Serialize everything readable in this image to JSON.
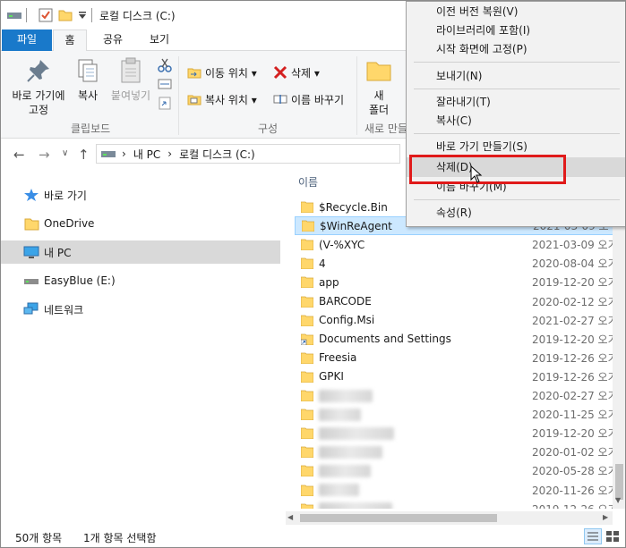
{
  "title": "로컬 디스크 (C:)",
  "ribbon_tabs": [
    "파일",
    "홈",
    "공유",
    "보기"
  ],
  "ribbon": {
    "pin_label": "바로 가기에\n고정",
    "copy_label": "복사",
    "paste_label": "붙여넣기",
    "clipboard_group": "클립보드",
    "move_to_label": "이동 위치 ▾",
    "copy_to_label": "복사 위치 ▾",
    "delete_label": "삭제 ▾",
    "rename_label": "이름 바꾸기",
    "organize_group": "구성",
    "new_folder_label": "새\n폴더",
    "new_group": "새로 만들"
  },
  "address": {
    "crumbs": [
      "내 PC",
      "로컬 디스크 (C:)"
    ]
  },
  "nav_pane": {
    "items": [
      {
        "label": "바로 가기",
        "icon": "star-icon"
      },
      {
        "label": "OneDrive",
        "icon": "folder-icon"
      },
      {
        "label": "내 PC",
        "icon": "computer-icon"
      },
      {
        "label": "EasyBlue (E:)",
        "icon": "drive-icon"
      },
      {
        "label": "네트워크",
        "icon": "network-icon"
      }
    ]
  },
  "file_list": {
    "column_name": "이름",
    "rows": [
      {
        "name": "$Recycle.Bin",
        "date": ""
      },
      {
        "name": "$WinReAgent",
        "date": "2021-03-09 오"
      },
      {
        "name": "(V-%XYC",
        "date": "2021-03-09 오기"
      },
      {
        "name": "4",
        "date": "2020-08-04 오기"
      },
      {
        "name": "app",
        "date": "2019-12-20 오기"
      },
      {
        "name": "BARCODE",
        "date": "2020-02-12 오기"
      },
      {
        "name": "Config.Msi",
        "date": "2021-02-27 오기"
      },
      {
        "name": "Documents and Settings",
        "date": "2019-12-20 오기"
      },
      {
        "name": "Freesia",
        "date": "2019-12-26 오기"
      },
      {
        "name": "GPKI",
        "date": "2019-12-26 오기"
      },
      {
        "name": "",
        "date": "2020-02-27 오기"
      },
      {
        "name": "",
        "date": "2020-11-25 오기"
      },
      {
        "name": "",
        "date": "2019-12-20 오기"
      },
      {
        "name": "",
        "date": "2020-01-02 오기"
      },
      {
        "name": "",
        "date": "2020-05-28 오기"
      },
      {
        "name": "",
        "date": "2020-11-26 오기"
      },
      {
        "name": "",
        "date": "2019-12-26 오기"
      }
    ]
  },
  "status": {
    "item_count": "50개 항목",
    "selected": "1개 항목 선택함"
  },
  "context_menu": {
    "items": [
      {
        "label": "이전 버전 복원(V)"
      },
      {
        "label": "라이브러리에 포함(I)"
      },
      {
        "label": "시작 화면에 고정(P)"
      },
      {
        "label": "보내기(N)"
      },
      {
        "label": "잘라내기(T)"
      },
      {
        "label": "복사(C)"
      },
      {
        "label": "바로 가기 만들기(S)"
      },
      {
        "label": "삭제(D)"
      },
      {
        "label": "이름 바꾸기(M)"
      },
      {
        "label": "속성(R)"
      }
    ]
  },
  "colors": {
    "file_tab": "#1979ca",
    "folder": "#ffd76b",
    "selection": "#cce8ff",
    "highlight_box": "#e01a1a"
  }
}
